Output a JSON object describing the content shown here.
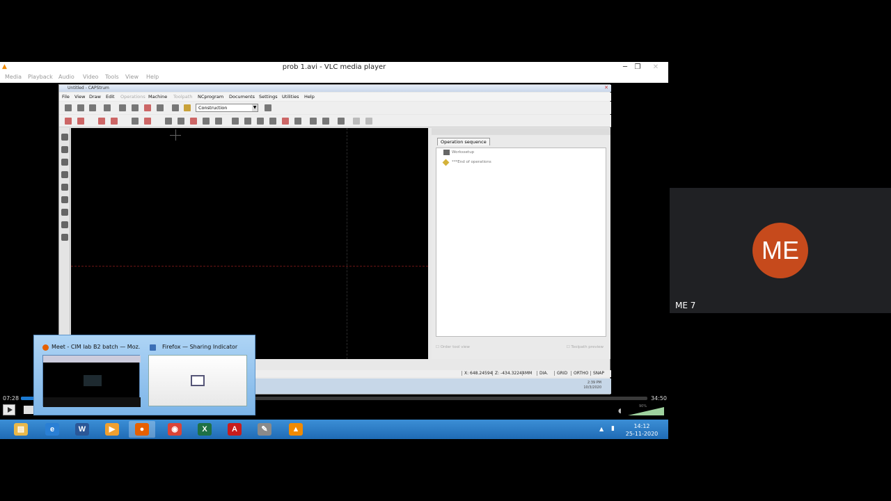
{
  "vlc": {
    "title": "prob 1.avi - VLC media player",
    "window_controls": [
      "─",
      "❐",
      "✕"
    ],
    "menus": [
      "Media",
      "Playback",
      "Audio",
      "Video",
      "Tools",
      "View",
      "Help"
    ],
    "time_elapsed": "07:28",
    "time_total": "34:50",
    "progress_fraction": 0.215,
    "volume_percent": "90%"
  },
  "capstrum": {
    "title": "Untitled - CAPStrum",
    "menus": [
      {
        "label": "File",
        "enabled": true
      },
      {
        "label": "View",
        "enabled": true
      },
      {
        "label": "Draw",
        "enabled": true
      },
      {
        "label": "Edit",
        "enabled": true
      },
      {
        "label": "Operations",
        "enabled": false
      },
      {
        "label": "Machine",
        "enabled": true
      },
      {
        "label": "Toolpath",
        "enabled": false
      },
      {
        "label": "NCprogram",
        "enabled": true
      },
      {
        "label": "Documents",
        "enabled": true
      },
      {
        "label": "Settings",
        "enabled": true
      },
      {
        "label": "Utilities",
        "enabled": true
      },
      {
        "label": "Help",
        "enabled": true
      }
    ],
    "mode_select": "Construction",
    "panel": {
      "tab": "Operation sequence",
      "items": [
        "Workssetup",
        "***End of operations"
      ],
      "footer_left": "Order tool view",
      "footer_right": "Toolpath preview"
    },
    "status": {
      "x": "X: 648.24594",
      "z": "Z: -434.32244",
      "units": "MM",
      "dia": "DIA.",
      "grid": "GRID",
      "ortho": "ORTHO",
      "snap": "SNAP"
    },
    "os_clock": {
      "time": "2:39 PM",
      "date": "10/3/2020"
    }
  },
  "thumbnails": [
    {
      "title": "Meet - CIM lab B2 batch — Moz...",
      "icon_color": "#e66000"
    },
    {
      "title": "Firefox — Sharing Indicator",
      "icon_color": "#3b6fb6"
    }
  ],
  "taskbar": {
    "apps": [
      {
        "name": "explorer-icon",
        "glyph": "▤",
        "color": "#e9b84a"
      },
      {
        "name": "ie-icon",
        "glyph": "e",
        "color": "#2a7fd4"
      },
      {
        "name": "word-icon",
        "glyph": "W",
        "color": "#2b5797"
      },
      {
        "name": "media-icon",
        "glyph": "▶",
        "color": "#f0a030"
      },
      {
        "name": "firefox-icon",
        "glyph": "●",
        "color": "#e66000"
      },
      {
        "name": "chrome-icon",
        "glyph": "◉",
        "color": "#db4437"
      },
      {
        "name": "excel-icon",
        "glyph": "X",
        "color": "#1e7145"
      },
      {
        "name": "acrobat-icon",
        "glyph": "A",
        "color": "#c81c1c"
      },
      {
        "name": "tool-icon",
        "glyph": "✎",
        "color": "#8a8a8a"
      },
      {
        "name": "vlc-icon",
        "glyph": "▲",
        "color": "#f08a00"
      }
    ],
    "active_index": 4,
    "time": "14:12",
    "date": "25-11-2020"
  },
  "participant": {
    "initials": "ME",
    "name": "ME 7",
    "avatar_color": "#c64a1c"
  }
}
